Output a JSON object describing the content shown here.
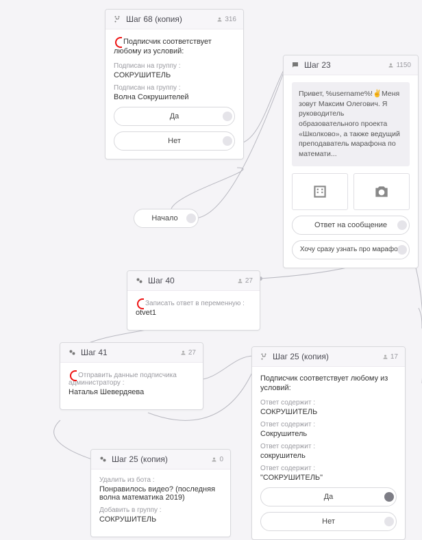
{
  "start": {
    "label": "Начало"
  },
  "node68": {
    "title": "Шаг 68 (копия)",
    "stat": "316",
    "heading": "Подписчик соответствует любому из условий:",
    "conds": [
      {
        "label": "Подписан на группу :",
        "value": "СОКРУШИТЕЛЬ"
      },
      {
        "label": "Подписан на группу :",
        "value": "Волна Сокрушителей"
      }
    ],
    "yes": "Да",
    "no": "Нет"
  },
  "node23": {
    "title": "Шаг 23",
    "stat": "1150",
    "message": "Привет, %username%!✌Меня зовут Максим Олегович. Я руководитель образовательного проекта «Школково», а также ведущий преподаватель марафона по математи...",
    "btn1": "Ответ на сообщение",
    "btn2": "Хочу сразу узнать про марафон"
  },
  "node40": {
    "title": "Шаг 40",
    "stat": "27",
    "action_label": "Записать ответ в переменную :",
    "action_value": "otvet1"
  },
  "node41": {
    "title": "Шаг 41",
    "stat": "27",
    "action_label": "Отправить данные подписчика администратору :",
    "action_value": "Наталья Шевердяева"
  },
  "node25a": {
    "title": "Шаг 25 (копия)",
    "stat": "0",
    "a1_label": "Удалить из бота :",
    "a1_value": "Понравилось видео? (последняя волна математика 2019)",
    "a2_label": "Добавить в группу :",
    "a2_value": "СОКРУШИТЕЛЬ"
  },
  "node25b": {
    "title": "Шаг 25 (копия)",
    "stat": "17",
    "heading": "Подписчик соответствует любому из условий:",
    "conds": [
      {
        "label": "Ответ содержит :",
        "value": "СОКРУШИТЕЛЬ"
      },
      {
        "label": "Ответ содержит :",
        "value": "Сокрушитель"
      },
      {
        "label": "Ответ содержит :",
        "value": "сокрушитель"
      },
      {
        "label": "Ответ содержит :",
        "value": "\"СОКРУШИТЕЛЬ\""
      }
    ],
    "yes": "Да",
    "no": "Нет"
  }
}
